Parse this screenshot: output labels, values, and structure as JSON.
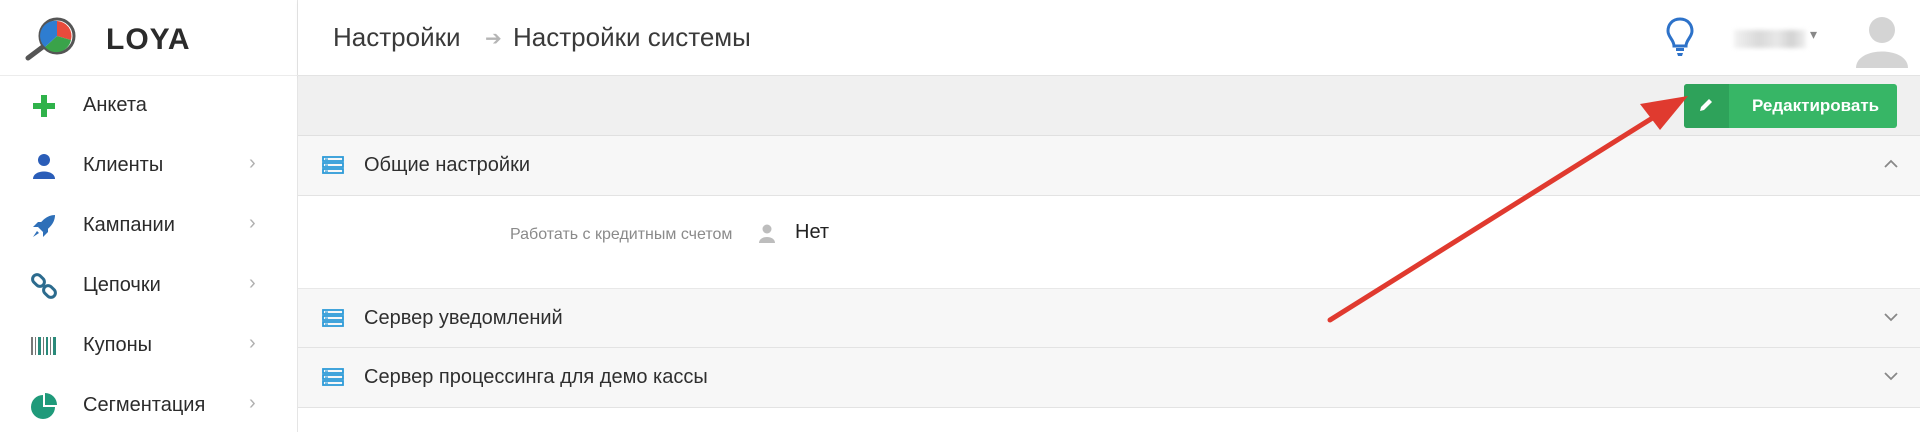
{
  "app": {
    "logo_text": "LOYA"
  },
  "sidebar": {
    "items": [
      {
        "label": "Анкета",
        "icon": "plus-icon",
        "has_chevron": false
      },
      {
        "label": "Клиенты",
        "icon": "user-icon",
        "has_chevron": true
      },
      {
        "label": "Кампании",
        "icon": "rocket-icon",
        "has_chevron": true
      },
      {
        "label": "Цепочки",
        "icon": "chain-icon",
        "has_chevron": true
      },
      {
        "label": "Купоны",
        "icon": "barcode-icon",
        "has_chevron": true
      },
      {
        "label": "Сегментация",
        "icon": "pie-chart-icon",
        "has_chevron": true
      }
    ],
    "chevron": "›"
  },
  "header": {
    "breadcrumb": [
      "Настройки",
      "Настройки системы"
    ],
    "breadcrumb_separator": "➔",
    "user_caret": "▾"
  },
  "toolbar": {
    "edit_label": "Редактировать"
  },
  "sections": [
    {
      "title": "Общие настройки",
      "expanded": true,
      "fields": [
        {
          "label": "Работать с кредитным счетом",
          "value": "Нет"
        }
      ]
    },
    {
      "title": "Сервер уведомлений",
      "expanded": false
    },
    {
      "title": "Сервер процессинга для демо кассы",
      "expanded": false
    }
  ],
  "colors": {
    "accent_green": "#37b666",
    "icon_blue": "#2d8fd5",
    "annotation_red": "#e03a2f"
  }
}
